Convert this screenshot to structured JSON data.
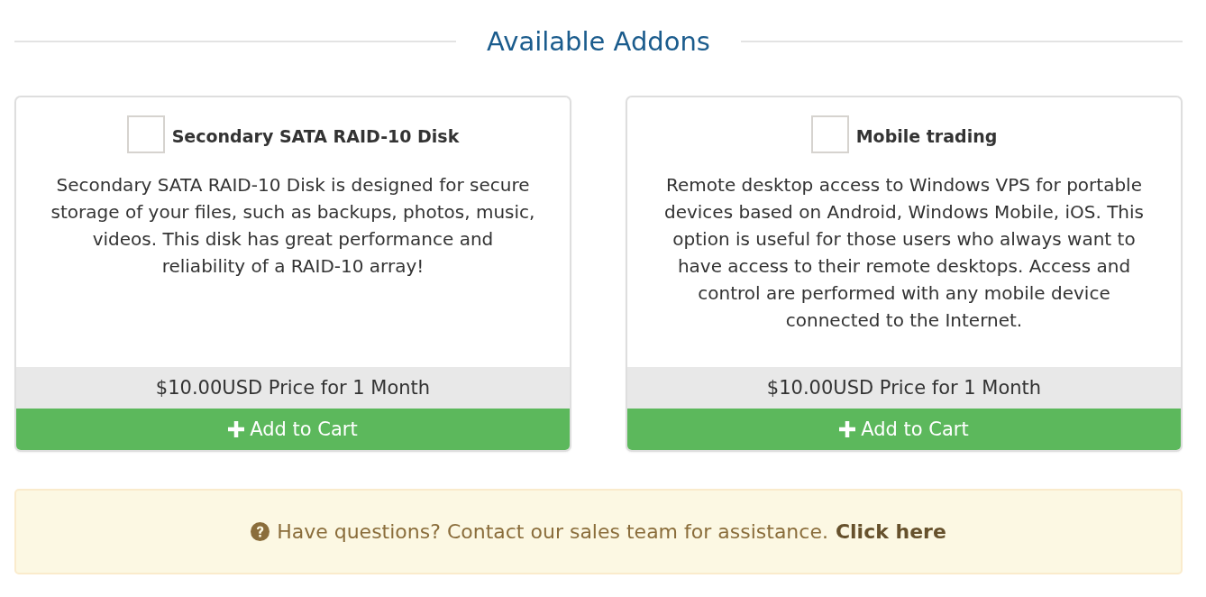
{
  "heading": "Available Addons",
  "addons": [
    {
      "title": "Secondary SATA RAID-10 Disk",
      "checked": false,
      "description": "Secondary SATA RAID-10 Disk is designed for secure storage of your files, such as backups, photos, music, videos. This disk has great performance and reliability of a RAID-10 array!",
      "price": "$10.00USD Price for 1 Month",
      "button": "Add to Cart"
    },
    {
      "title": "Mobile trading",
      "checked": false,
      "description": "Remote desktop access to Windows VPS for portable devices based on Android, Windows Mobile, iOS. This option is useful for those users who always want to have access to their remote desktops. Access and control are performed with any mobile device connected to the Internet.",
      "price": "$10.00USD Price for 1 Month",
      "button": "Add to Cart"
    }
  ],
  "help": {
    "text": "Have questions? Contact our sales team for assistance.",
    "link": "Click here"
  }
}
